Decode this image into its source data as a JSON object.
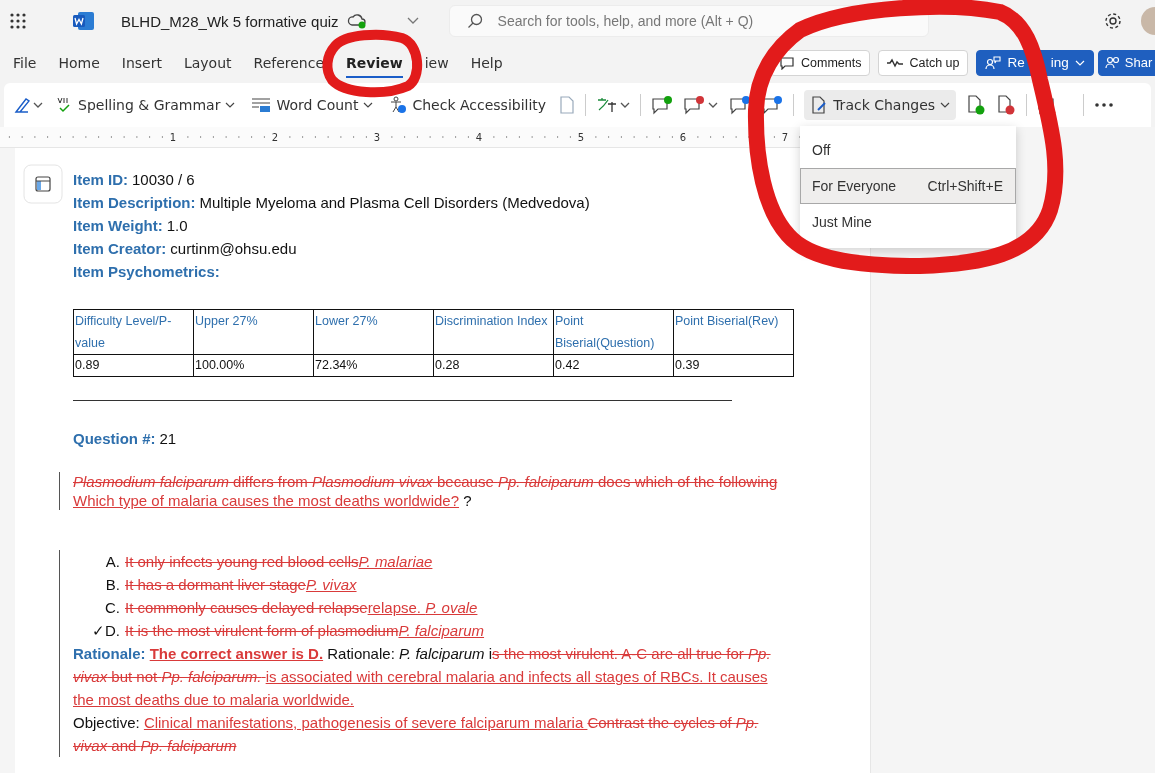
{
  "app_bar": {
    "document_title": "BLHD_M28_Wk 5 formative quiz",
    "search": {
      "placeholder": "Search for tools, help, and more (Alt + Q)"
    }
  },
  "menu_tabs": [
    {
      "label": "File",
      "selected": false
    },
    {
      "label": "Home",
      "selected": false
    },
    {
      "label": "Insert",
      "selected": false
    },
    {
      "label": "Layout",
      "selected": false
    },
    {
      "label": "Reference",
      "selected": false
    },
    {
      "label": "Review",
      "selected": true
    },
    {
      "label": "iew",
      "selected": false
    },
    {
      "label": "Help",
      "selected": false
    }
  ],
  "header_buttons": [
    {
      "label_parts": [
        "Comments"
      ],
      "kind": "comments"
    },
    {
      "label_parts": [
        "Catch up"
      ],
      "kind": "catch_up"
    },
    {
      "label_parts": [
        "Re",
        "ing"
      ],
      "kind": "reviewing"
    },
    {
      "label_parts": [
        "Shar"
      ],
      "kind": "share"
    }
  ],
  "ribbon": {
    "spelling": "Spelling & Grammar",
    "word_count": "Word Count",
    "accessibility": "Check Accessibility",
    "track_changes": "Track Changes"
  },
  "track_changes_menu": [
    {
      "label": "Off",
      "selected": false
    },
    {
      "label": "For Everyone",
      "shortcut": "Ctrl+Shift+E",
      "selected": true
    },
    {
      "label": "Just Mine",
      "selected": false
    }
  ],
  "ruler_numbers": [
    "1",
    "2",
    "3",
    "4",
    "5",
    "6",
    "7"
  ],
  "document": {
    "fields": [
      {
        "label": "Item ID:",
        "value": "10030 / 6"
      },
      {
        "label": "Item Description:",
        "value": "Multiple Myeloma and Plasma Cell Disorders (Medvedova)"
      },
      {
        "label": "Item Weight:",
        "value": "1.0"
      },
      {
        "label": "Item Creator:",
        "value": "curtinm@ohsu.edu"
      },
      {
        "label": "Item Psychometrics:"
      }
    ],
    "table": {
      "columns": [
        "Difficulty Level/P-value",
        "Upper 27%",
        "Lower 27%",
        "Discrimination Index",
        "Point Biserial(Question)",
        "Point Biserial(Rev)"
      ],
      "rows": [
        [
          "0.89",
          "100.00%",
          "72.34%",
          "0.28",
          "0.42",
          "0.39"
        ]
      ]
    },
    "question": {
      "label": "Question #:",
      "value": "21"
    },
    "paragraphs": [
      {
        "kind": "stem",
        "changed": true,
        "runs": [
          {
            "text": "*Plasmodium falciparum* differs from *Plasmodium vivax* because *Pp. falciparum* does which of the following",
            "kind": "del"
          },
          {
            "text": " Which type of malaria causes the most deaths worldwide?",
            "kind": "ins"
          },
          {
            "text": " ?",
            "kind": "plain"
          }
        ]
      },
      {
        "kind": "option",
        "marker": "A.",
        "changed": true,
        "runs": [
          {
            "text": "It only infects young red blood cells",
            "kind": "del"
          },
          {
            "text": "*P. malariae*",
            "kind": "ins"
          }
        ]
      },
      {
        "kind": "option",
        "marker": "B.",
        "changed": true,
        "runs": [
          {
            "text": "It has a dormant liver stage",
            "kind": "del"
          },
          {
            "text": "*P. vivax*",
            "kind": "ins"
          }
        ]
      },
      {
        "kind": "option",
        "marker": "C.",
        "changed": true,
        "runs": [
          {
            "text": "It commonly causes delayed relapse",
            "kind": "del"
          },
          {
            "text": "relapse. *P. ovale*",
            "kind": "ins"
          }
        ]
      },
      {
        "kind": "option",
        "marker": "✓D.",
        "changed": true,
        "runs": [
          {
            "text": "It is the most virulent form of plasmodium",
            "kind": "del"
          },
          {
            "text": "*P. falciparum*",
            "kind": "ins"
          }
        ]
      },
      {
        "kind": "prose",
        "changed": true,
        "runs": [
          {
            "text": "Rationale: ",
            "kind": "label"
          },
          {
            "text": "**The correct answer is D.**",
            "kind": "ins"
          },
          {
            "text": " Rationale: *P. falciparum* i",
            "kind": "plain"
          },
          {
            "text": "s the most virulent. A-C are all true for *Pp. vivax* but not *Pp. falciparum.* ",
            "kind": "del"
          },
          {
            "text": "is associated with cerebral malaria and infects all stages of RBCs.  It causes the most deaths due to malaria worldwide. ",
            "kind": "ins"
          }
        ]
      },
      {
        "kind": "prose",
        "changed": true,
        "runs": [
          {
            "text": "Objective: ",
            "kind": "plain"
          },
          {
            "text": "Clinical manifestations, pathogenesis of severe falciparum malaria ",
            "kind": "ins"
          },
          {
            "text": "Contrast the cycles of *Pp. vivax* and *Pp. falciparum*",
            "kind": "del"
          }
        ]
      }
    ]
  }
}
